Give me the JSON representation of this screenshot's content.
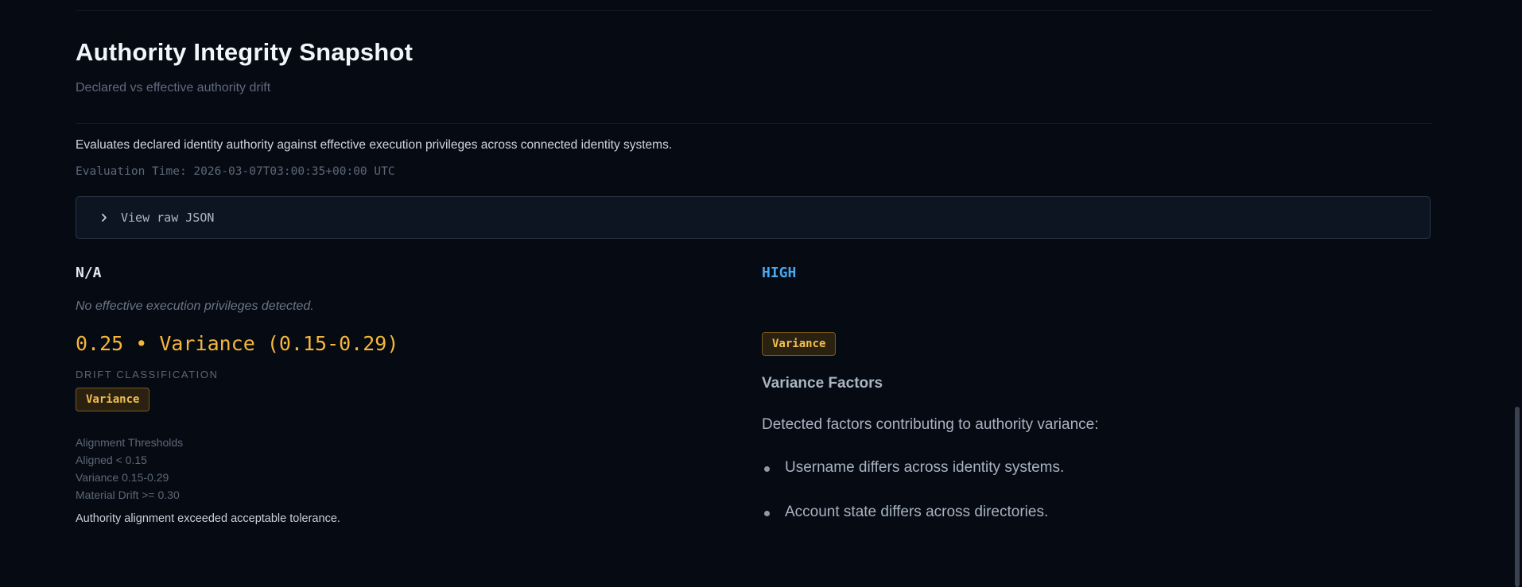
{
  "header": {
    "title": "Authority Integrity Snapshot",
    "subtitle": "Declared vs effective authority drift"
  },
  "summary": {
    "description": "Evaluates declared identity authority against effective execution privileges across connected identity systems.",
    "evaluation_time": "Evaluation Time: 2026-03-07T03:00:35+00:00 UTC"
  },
  "raw_json": {
    "label": "View raw JSON",
    "icon": "chevron-right-icon",
    "expanded": false
  },
  "effective": {
    "value": "N/A",
    "note": "No effective execution privileges detected."
  },
  "drift": {
    "score_line": "0.25 • Variance (0.15-0.29)",
    "classification_label": "DRIFT CLASSIFICATION",
    "badge": "Variance",
    "thresholds": {
      "heading": "Alignment Thresholds",
      "items": [
        "Aligned < 0.15",
        "Variance 0.15-0.29",
        "Material Drift >= 0.30"
      ]
    },
    "tolerance_note": "Authority alignment exceeded acceptable tolerance."
  },
  "declared": {
    "value": "HIGH",
    "badge": "Variance"
  },
  "factors": {
    "title": "Variance Factors",
    "intro": "Detected factors contributing to authority variance:",
    "items": [
      "Username differs across identity systems.",
      "Account state differs across directories."
    ]
  },
  "colors": {
    "background": "#060a12",
    "accent_warning": "#f5b63a",
    "accent_info": "#4aa8f0",
    "badge_border": "#7a5a1b"
  }
}
